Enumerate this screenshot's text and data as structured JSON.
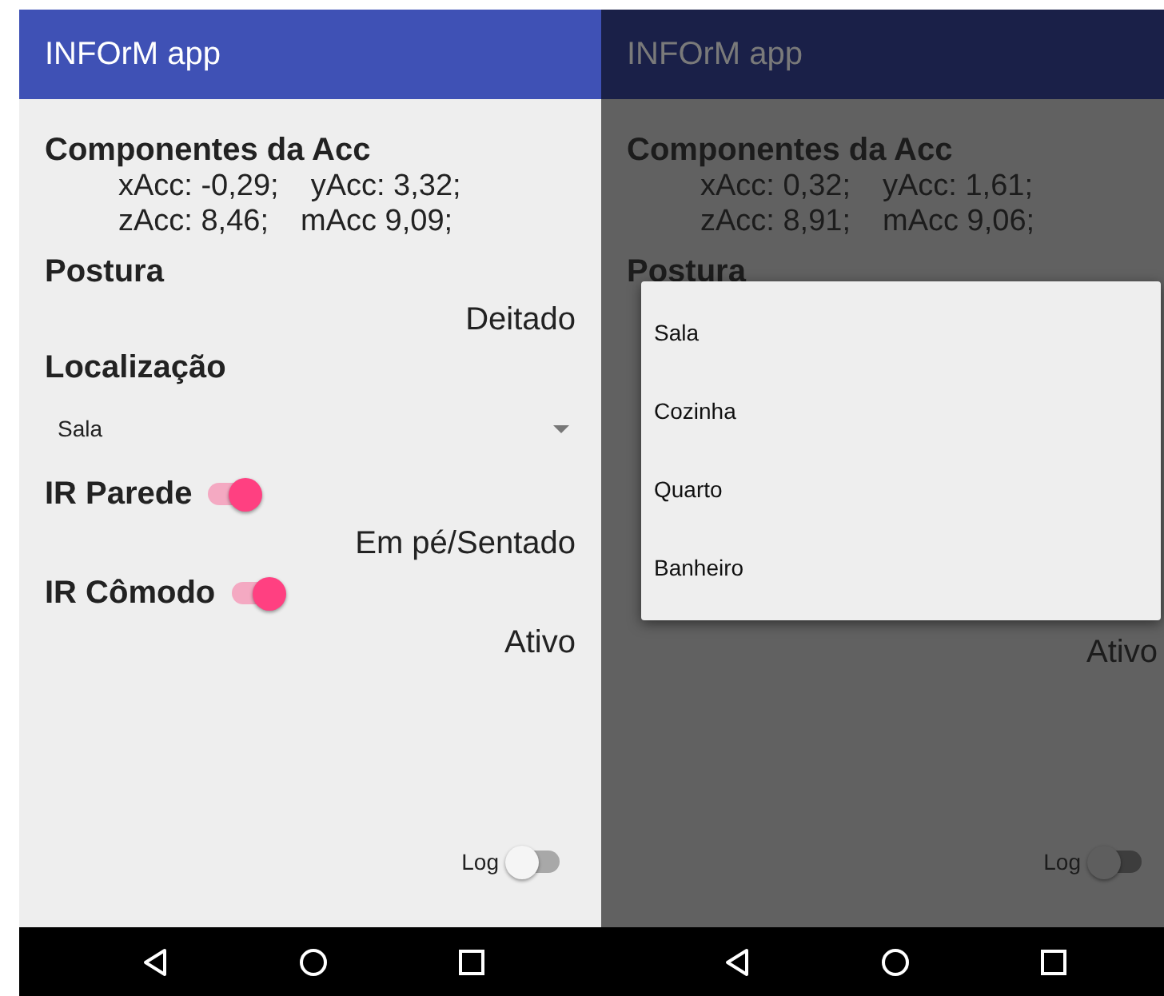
{
  "screens": [
    {
      "title": "INFOrM app",
      "dimmed": false,
      "items": [
        {
          "kind": "heading",
          "text": "Componentes da Acc"
        },
        {
          "kind": "readings",
          "lines": [
            [
              "xAcc: -0,29;",
              "yAcc: 3,32;"
            ],
            [
              "zAcc: 8,46;",
              "mAcc 9,09;"
            ]
          ]
        },
        {
          "kind": "heading",
          "text": "Postura"
        },
        {
          "kind": "value",
          "text": "Deitado"
        },
        {
          "kind": "heading",
          "text": "Localização"
        },
        {
          "kind": "spinner",
          "text": "Sala"
        },
        {
          "kind": "switch",
          "text": "IR Parede",
          "on": true
        },
        {
          "kind": "value",
          "text": "Em pé/Sentado"
        },
        {
          "kind": "switch",
          "text": "IR Cômodo",
          "on": true
        },
        {
          "kind": "value",
          "text": "Ativo"
        }
      ],
      "log": {
        "label": "Log",
        "on": false
      }
    },
    {
      "title": "INFOrM app",
      "dimmed": true,
      "items": [
        {
          "kind": "heading",
          "text": "Componentes da Acc"
        },
        {
          "kind": "readings",
          "lines": [
            [
              "xAcc: 0,32;",
              "yAcc: 1,61;"
            ],
            [
              "zAcc: 8,91;",
              "mAcc 9,06;"
            ]
          ]
        },
        {
          "kind": "heading",
          "text": "Postura"
        },
        {
          "kind": "menu",
          "options": [
            {
              "label": "Sala"
            },
            {
              "label": "Cozinha"
            },
            {
              "label": "Quarto"
            },
            {
              "label": "Banheiro"
            }
          ]
        },
        {
          "kind": "value",
          "text": "Ativo"
        }
      ],
      "log": {
        "label": "Log",
        "on": false
      }
    }
  ]
}
